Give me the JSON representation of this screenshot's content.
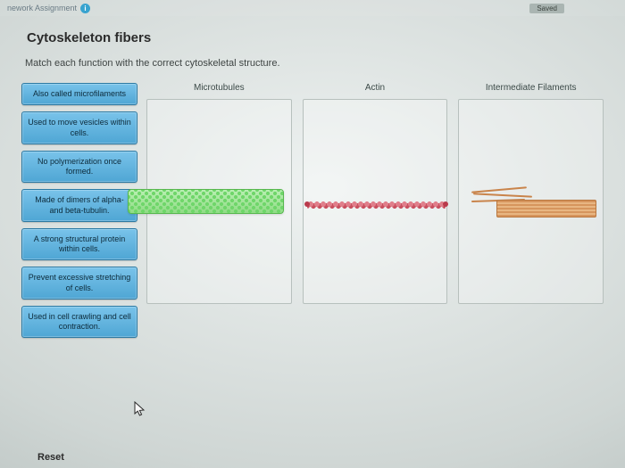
{
  "topbar": {
    "crumb": "nework Assignment",
    "saved": "Saved"
  },
  "title": "Cytoskeleton fibers",
  "instruction": "Match each function with the correct cytoskeletal structure.",
  "chips": [
    "Also called microfilaments",
    "Used to move vesicles within cells.",
    "No polymerization once formed.",
    "Made of dimers of alpha- and beta-tubulin.",
    "A strong structural protein within cells.",
    "Prevent excessive stretching of cells.",
    "Used in cell crawling and cell contraction."
  ],
  "targets": {
    "microtubules": "Microtubules",
    "actin": "Actin",
    "intermediate": "Intermediate Filaments"
  },
  "reset": "Reset"
}
